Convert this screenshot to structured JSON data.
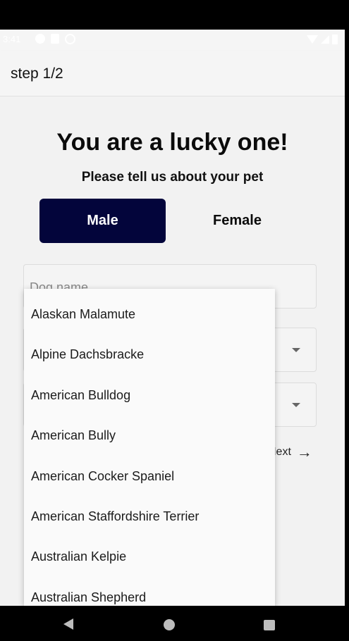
{
  "status_bar": {
    "time": "3:41",
    "left_icons": [
      "a-circle-icon",
      "sim-card-icon",
      "at-icon"
    ],
    "right_icons": [
      "wifi-icon",
      "signal-icon",
      "battery-icon"
    ]
  },
  "app_bar": {
    "title": "step 1/2"
  },
  "main": {
    "heading": "You are a lucky one!",
    "subheading": "Please tell us about your pet",
    "gender": {
      "male_label": "Male",
      "female_label": "Female",
      "selected": "Male"
    },
    "dog_name_placeholder": "Dog name",
    "next_label": "Next"
  },
  "breed_dropdown": {
    "options": [
      "Alaskan Malamute",
      "Alpine Dachsbracke",
      "American Bulldog",
      "American Bully",
      "American Cocker Spaniel",
      "American Staffordshire Terrier",
      "Australian Kelpie",
      "Australian Shepherd"
    ]
  },
  "nav_bar": {
    "buttons": [
      "back-icon",
      "home-icon",
      "recents-icon"
    ]
  },
  "colors": {
    "primary": "#03053b",
    "background": "#f2f2f2",
    "text": "#111111"
  }
}
